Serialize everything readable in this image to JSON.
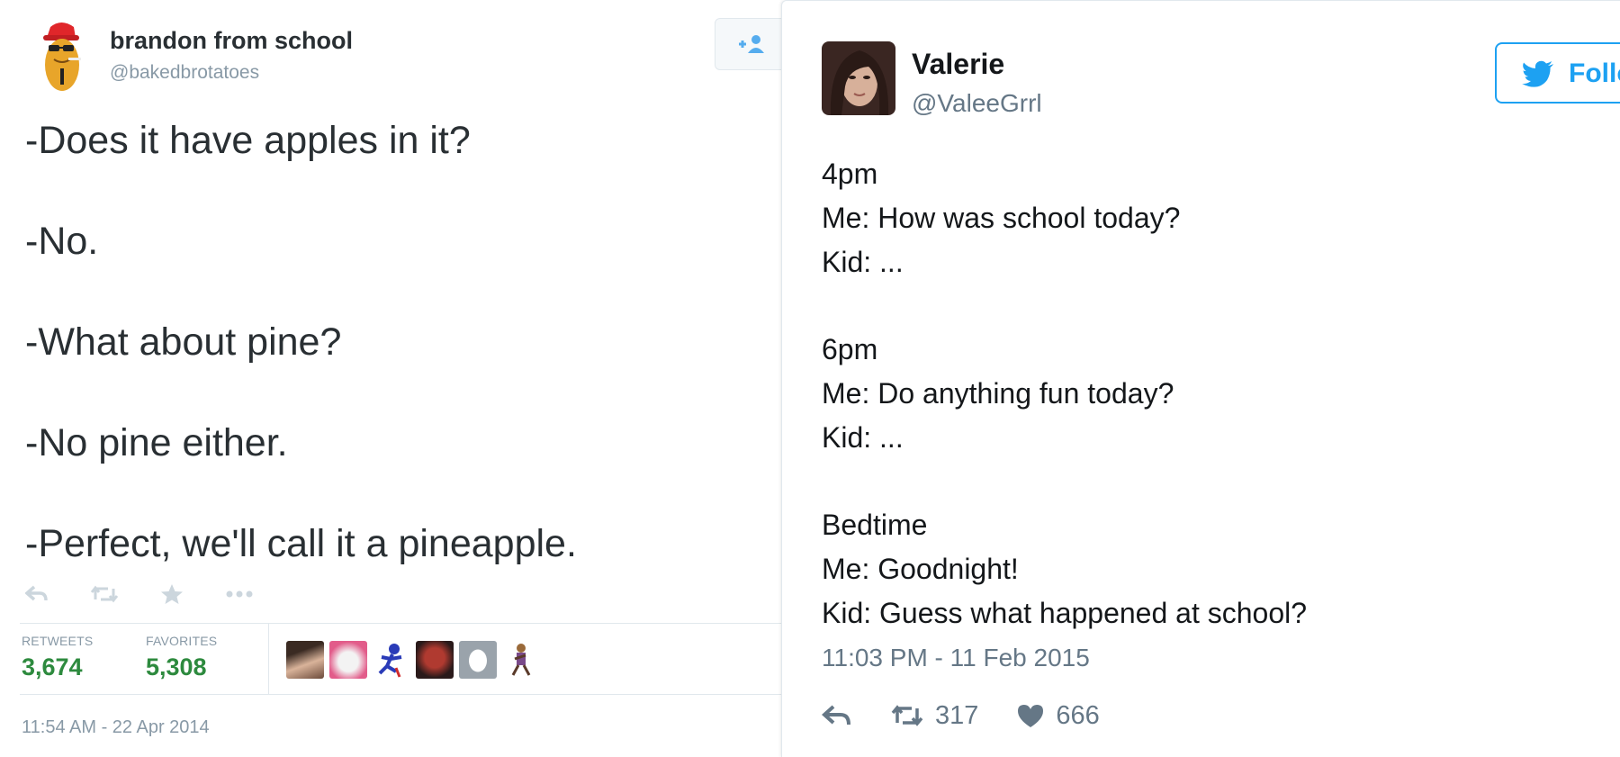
{
  "left_tweet": {
    "author_name": "brandon from school",
    "author_handle": "@bakedbrotatoes",
    "lines": [
      "-Does it have apples in it?",
      "-No.",
      "-What about pine?",
      "-No pine either.",
      "-Perfect, we'll call it a pineapple."
    ],
    "retweets_label": "RETWEETS",
    "retweets_count": "3,674",
    "favorites_label": "FAVORITES",
    "favorites_count": "5,308",
    "timestamp": "11:54 AM - 22 Apr 2014",
    "icons": [
      "reply-icon",
      "retweet-icon",
      "favorite-star-icon",
      "more-icon",
      "follow-person-icon"
    ]
  },
  "right_tweet": {
    "author_name": "Valerie",
    "author_handle": "@ValeeGrrl",
    "follow_label": "Follo",
    "lines": [
      "4pm",
      "Me: How was school today?",
      "Kid: ...",
      "6pm",
      "Me: Do anything fun today?",
      "Kid: ...",
      "Bedtime",
      "Me: Goodnight!",
      "Kid: Guess what happened at school?"
    ],
    "timestamp": "11:03 PM - 11 Feb 2015",
    "retweet_count": "317",
    "like_count": "666",
    "icons": [
      "reply-icon",
      "retweet-icon",
      "heart-icon",
      "twitter-bird-icon"
    ]
  },
  "colors": {
    "twitter_blue": "#1da1f2",
    "stat_green": "#2d8a3e",
    "muted_gray": "#8899a6"
  }
}
